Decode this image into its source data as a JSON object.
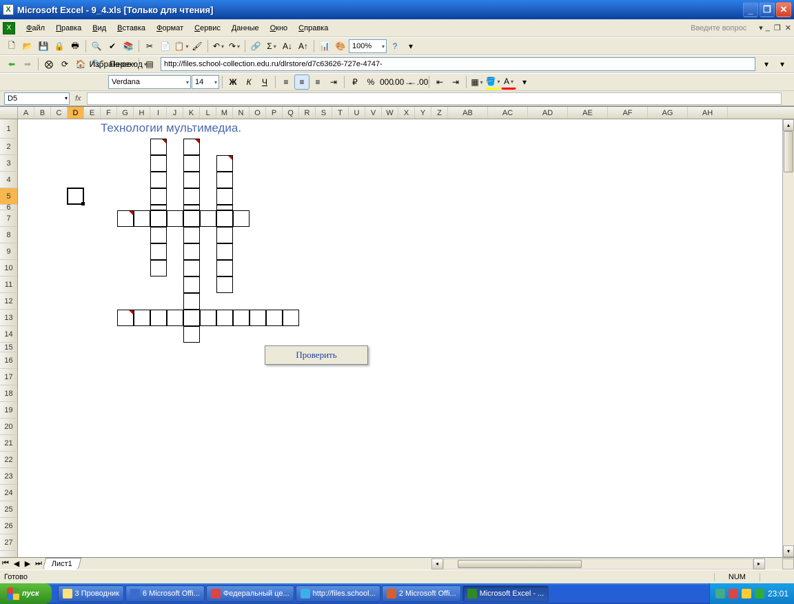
{
  "window": {
    "title": "Microsoft Excel - 9_4.xls  [Только для чтения]"
  },
  "menu": {
    "items": [
      "Файл",
      "Правка",
      "Вид",
      "Вставка",
      "Формат",
      "Сервис",
      "Данные",
      "Окно",
      "Справка"
    ],
    "ask_prompt": "Введите вопрос"
  },
  "web_toolbar": {
    "favorites": "Избранное",
    "goto": "Переход",
    "url": "http://files.school-collection.edu.ru/dlrstore/d7c63626-727e-4747-"
  },
  "format_toolbar": {
    "font": "Verdana",
    "size": "14",
    "zoom": "100%"
  },
  "namebox": "D5",
  "sheet": {
    "title_text": "Технологии мультимедиа.",
    "check_button": "Проверить",
    "cols_narrow": [
      "A",
      "B",
      "C",
      "D",
      "E",
      "F",
      "G",
      "H",
      "I",
      "J",
      "K",
      "L",
      "M",
      "N",
      "O",
      "P",
      "Q",
      "R",
      "S",
      "T",
      "U",
      "V",
      "W",
      "X",
      "Y",
      "Z"
    ],
    "cols_wide": [
      "AB",
      "AC",
      "AD",
      "AE",
      "AF",
      "AG",
      "AH"
    ],
    "rows": [
      1,
      2,
      3,
      4,
      5,
      6,
      7,
      8,
      9,
      10,
      11,
      12,
      13,
      14,
      15,
      16,
      17,
      18,
      19,
      20,
      21,
      22,
      23,
      24,
      25,
      26,
      27
    ],
    "selected_cell": "D5",
    "crossword_cells": [
      {
        "c": "I",
        "r": 2,
        "clue": true
      },
      {
        "c": "I",
        "r": 3
      },
      {
        "c": "I",
        "r": 4
      },
      {
        "c": "I",
        "r": 5
      },
      {
        "c": "I",
        "r": 6
      },
      {
        "c": "I",
        "r": 7
      },
      {
        "c": "I",
        "r": 8
      },
      {
        "c": "I",
        "r": 9
      },
      {
        "c": "I",
        "r": 10
      },
      {
        "c": "K",
        "r": 2,
        "clue": true
      },
      {
        "c": "K",
        "r": 3
      },
      {
        "c": "K",
        "r": 4
      },
      {
        "c": "K",
        "r": 5
      },
      {
        "c": "K",
        "r": 6
      },
      {
        "c": "K",
        "r": 7
      },
      {
        "c": "K",
        "r": 8
      },
      {
        "c": "K",
        "r": 9
      },
      {
        "c": "K",
        "r": 10
      },
      {
        "c": "K",
        "r": 11
      },
      {
        "c": "K",
        "r": 12
      },
      {
        "c": "K",
        "r": 13
      },
      {
        "c": "K",
        "r": 14
      },
      {
        "c": "M",
        "r": 3,
        "clue": true
      },
      {
        "c": "M",
        "r": 4
      },
      {
        "c": "M",
        "r": 5
      },
      {
        "c": "M",
        "r": 6
      },
      {
        "c": "M",
        "r": 7
      },
      {
        "c": "M",
        "r": 8
      },
      {
        "c": "M",
        "r": 9
      },
      {
        "c": "M",
        "r": 10
      },
      {
        "c": "M",
        "r": 11
      },
      {
        "c": "G",
        "r": 7,
        "clue": true
      },
      {
        "c": "H",
        "r": 7
      },
      {
        "c": "J",
        "r": 7
      },
      {
        "c": "L",
        "r": 7
      },
      {
        "c": "N",
        "r": 7
      },
      {
        "c": "G",
        "r": 13,
        "clue": true
      },
      {
        "c": "H",
        "r": 13
      },
      {
        "c": "I",
        "r": 13
      },
      {
        "c": "J",
        "r": 13
      },
      {
        "c": "L",
        "r": 13
      },
      {
        "c": "M",
        "r": 13
      },
      {
        "c": "N",
        "r": 13
      },
      {
        "c": "O",
        "r": 13
      },
      {
        "c": "P",
        "r": 13
      },
      {
        "c": "Q",
        "r": 13
      }
    ]
  },
  "tabs": {
    "sheet1": "Лист1"
  },
  "status": {
    "ready": "Готово",
    "num": "NUM"
  },
  "taskbar": {
    "start": "пуск",
    "buttons": [
      {
        "label": "3 Проводник",
        "color": "#fce27a"
      },
      {
        "label": "6 Microsoft Offi...",
        "color": "#3b6bcf"
      },
      {
        "label": "Федеральный це...",
        "color": "#d44"
      },
      {
        "label": "http://files.school...",
        "color": "#3bb0e8"
      },
      {
        "label": "2 Microsoft Offi...",
        "color": "#d85f2a"
      },
      {
        "label": "Microsoft Excel - ...",
        "color": "#2f8b1f",
        "active": true
      }
    ],
    "clock": "23:01"
  }
}
